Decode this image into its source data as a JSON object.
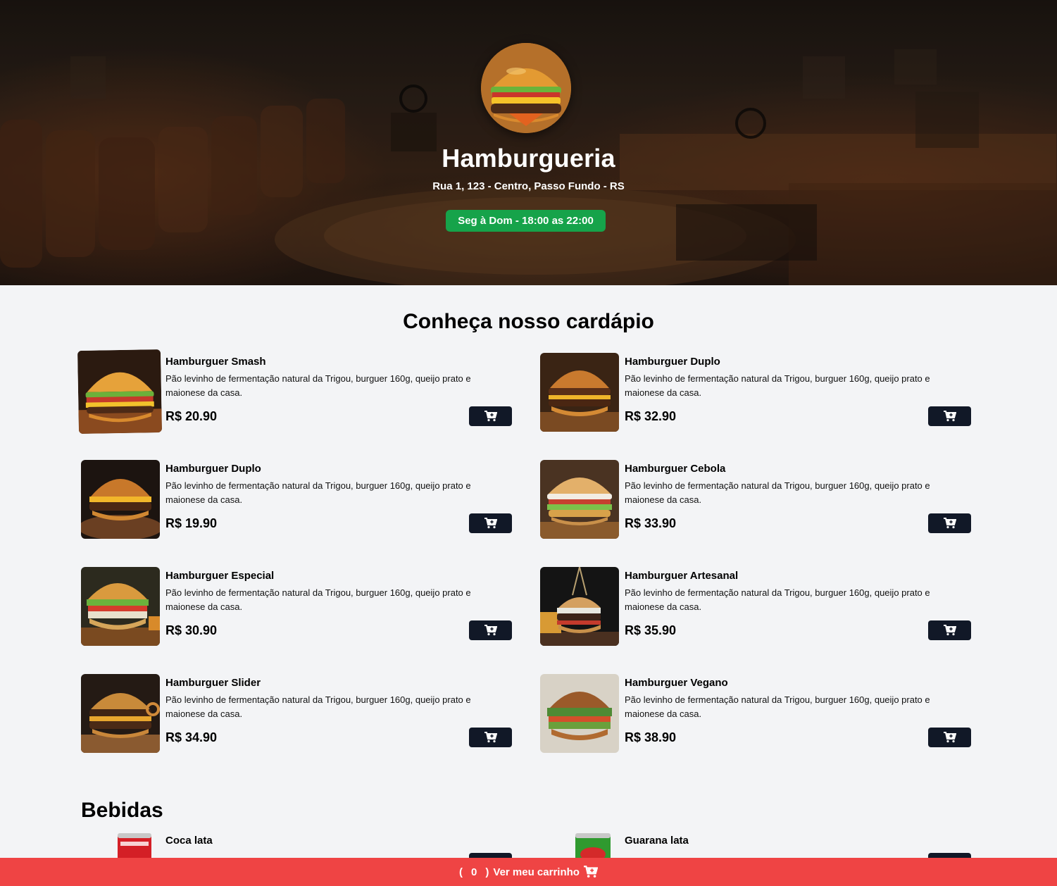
{
  "hero": {
    "title": "Hamburgueria",
    "address": "Rua 1, 123 - Centro, Passo Fundo - RS",
    "hours": "Seg à Dom - 18:00 as 22:00"
  },
  "menu": {
    "title": "Conheça nosso cardápio",
    "items": [
      {
        "name": "Hamburguer Smash",
        "description": "Pão levinho de fermentação natural da Trigou, burguer 160g, queijo prato e maionese da casa.",
        "price": "R$ 20.90"
      },
      {
        "name": "Hamburguer Duplo",
        "description": "Pão levinho de fermentação natural da Trigou, burguer 160g, queijo prato e maionese da casa.",
        "price": "R$ 32.90"
      },
      {
        "name": "Hamburguer Duplo",
        "description": "Pão levinho de fermentação natural da Trigou, burguer 160g, queijo prato e maionese da casa.",
        "price": "R$ 19.90"
      },
      {
        "name": "Hamburguer Cebola",
        "description": "Pão levinho de fermentação natural da Trigou, burguer 160g, queijo prato e maionese da casa.",
        "price": "R$ 33.90"
      },
      {
        "name": "Hamburguer Especial",
        "description": "Pão levinho de fermentação natural da Trigou, burguer 160g, queijo prato e maionese da casa.",
        "price": "R$ 30.90"
      },
      {
        "name": "Hamburguer Artesanal",
        "description": "Pão levinho de fermentação natural da Trigou, burguer 160g, queijo prato e maionese da casa.",
        "price": "R$ 35.90"
      },
      {
        "name": "Hamburguer Slider",
        "description": "Pão levinho de fermentação natural da Trigou, burguer 160g, queijo prato e maionese da casa.",
        "price": "R$ 34.90"
      },
      {
        "name": "Hamburguer Vegano",
        "description": "Pão levinho de fermentação natural da Trigou, burguer 160g, queijo prato e maionese da casa.",
        "price": "R$ 38.90"
      }
    ]
  },
  "drinks": {
    "title": "Bebidas",
    "items": [
      {
        "name": "Coca lata"
      },
      {
        "name": "Guarana lata"
      }
    ]
  },
  "cart": {
    "open_paren": "(",
    "count": "0",
    "close_paren": ")",
    "label": "Ver meu carrinho"
  },
  "icons": {
    "add_to_cart": "cart-plus-icon",
    "cart": "cart-icon"
  },
  "colors": {
    "hours_badge": "#16a34a",
    "button": "#111827",
    "cart_bar": "#ef4444",
    "background": "#f3f4f6"
  }
}
